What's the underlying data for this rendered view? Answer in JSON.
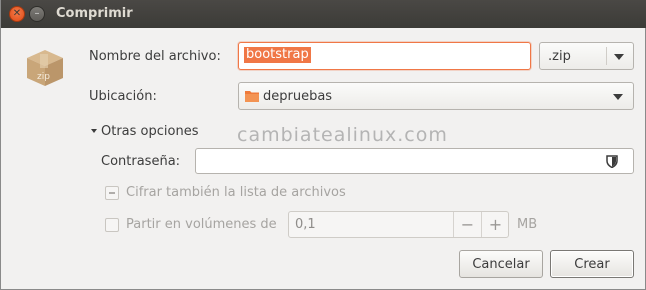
{
  "window": {
    "title": "Comprimir"
  },
  "form": {
    "filename_label": "Nombre del archivo:",
    "filename_value": "bootstrap",
    "extension_value": ".zip",
    "location_label": "Ubicación:",
    "location_value": "depruebas",
    "options_label": "Otras opciones",
    "password_label": "Contraseña:",
    "password_value": "",
    "encrypt_list_label": "Cifrar también la lista de archivos",
    "split_label": "Partir en volúmenes de",
    "split_value": "0,1",
    "split_unit": "MB",
    "minus_glyph": "−",
    "plus_glyph": "+",
    "zip_icon_label": "zip"
  },
  "watermark": "cambiatealinux.com",
  "buttons": {
    "cancel": "Cancelar",
    "create": "Crear"
  },
  "colors": {
    "accent": "#f07746",
    "titlebar": "#3c3b37"
  }
}
